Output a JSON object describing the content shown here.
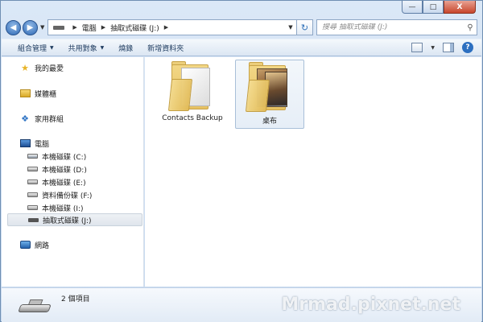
{
  "window": {
    "caption": {
      "minimize": "—",
      "maximize": "□",
      "close": "X"
    }
  },
  "address": {
    "crumbs": [
      "電腦",
      "抽取式磁碟 (J:)"
    ],
    "search_placeholder": "搜尋 抽取式磁碟 (J:)"
  },
  "toolbar": {
    "organize": "組合管理",
    "share": "共用對象",
    "burn": "燒錄",
    "new_folder": "新增資料夾",
    "help": "?"
  },
  "sidebar": {
    "favorites": "我的最愛",
    "libraries": "媒體櫃",
    "homegroup": "家用群組",
    "computer": "電腦",
    "drives": [
      {
        "label": "本機磁碟 (C:)"
      },
      {
        "label": "本機磁碟 (D:)"
      },
      {
        "label": "本機磁碟 (E:)"
      },
      {
        "label": "資料備份碟 (F:)"
      },
      {
        "label": "本機磁碟 (I:)"
      },
      {
        "label": "抽取式磁碟 (J:)"
      }
    ],
    "network": "網路",
    "selected": "抽取式磁碟 (J:)"
  },
  "content": {
    "items": [
      {
        "label": "Contacts Backup",
        "icon": "folder-document-icon"
      },
      {
        "label": "桌布",
        "icon": "folder-photo-icon"
      }
    ]
  },
  "details": {
    "item_count": "2 個項目",
    "watermark": "Mrmad.pixnet.net"
  }
}
